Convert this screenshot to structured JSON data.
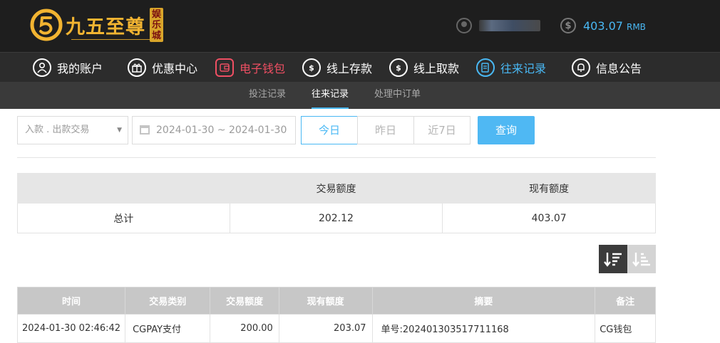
{
  "header": {
    "logo_text": "九五至尊",
    "logo_badge": [
      "娱",
      "乐",
      "城"
    ],
    "balance_amount": "403.07",
    "balance_unit": "RMB"
  },
  "nav": {
    "items": [
      {
        "label": "我的账户",
        "icon": "user-icon"
      },
      {
        "label": "优惠中心",
        "icon": "gift-icon"
      },
      {
        "label": "电子钱包",
        "icon": "wallet-icon"
      },
      {
        "label": "线上存款",
        "icon": "deposit-icon"
      },
      {
        "label": "线上取款",
        "icon": "withdraw-icon"
      },
      {
        "label": "往来记录",
        "icon": "records-icon"
      },
      {
        "label": "信息公告",
        "icon": "bell-icon"
      }
    ],
    "active_index": 5,
    "highlight_index": 2
  },
  "subnav": {
    "items": [
      "投注记录",
      "往来记录",
      "处理中订单"
    ],
    "active_index": 1
  },
  "filters": {
    "type_select": "入款 . 出款交易",
    "date_range": "2024-01-30 ~ 2024-01-30",
    "quick": [
      "今日",
      "昨日",
      "近7日"
    ],
    "quick_selected": 0,
    "query_label": "查询"
  },
  "summary": {
    "headers": [
      "",
      "交易额度",
      "现有额度"
    ],
    "row": [
      "总计",
      "202.12",
      "403.07"
    ]
  },
  "records": {
    "headers": [
      "时间",
      "交易类别",
      "交易额度",
      "现有额度",
      "摘要",
      "备注"
    ],
    "rows": [
      [
        "2024-01-30 02:46:42",
        "CGPAY支付",
        "200.00",
        "203.07",
        "单号:202401303517711168",
        "CG钱包"
      ]
    ]
  },
  "colors": {
    "accent": "#49b8f4",
    "wallet": "#ef4f63",
    "logo_gold": "#f2b431"
  }
}
